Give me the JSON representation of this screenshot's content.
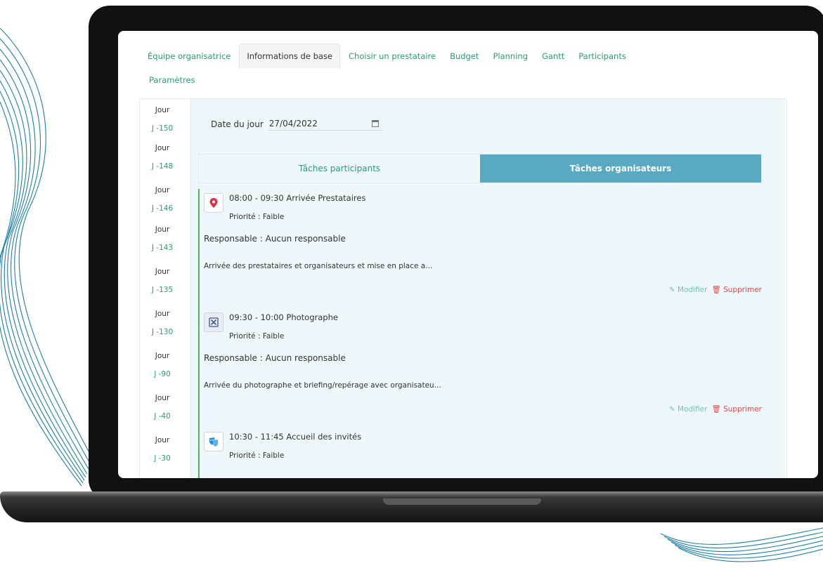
{
  "tabs": [
    {
      "label": "Équipe organisatrice",
      "active": false
    },
    {
      "label": "Informations de base",
      "active": true
    },
    {
      "label": "Choisir un prestataire",
      "active": false
    },
    {
      "label": "Budget",
      "active": false
    },
    {
      "label": "Planning",
      "active": false
    },
    {
      "label": "Gantt",
      "active": false
    },
    {
      "label": "Participants",
      "active": false
    }
  ],
  "tab_row2": {
    "label": "Paramètres"
  },
  "days": [
    {
      "label": "Jour",
      "num": "J -150"
    },
    {
      "label": "Jour",
      "num": "J -148"
    },
    {
      "label": "Jour",
      "num": "J -146"
    },
    {
      "label": "Jour",
      "num": "J -143"
    },
    {
      "label": "Jour",
      "num": "J -135"
    },
    {
      "label": "Jour",
      "num": "J -130"
    },
    {
      "label": "Jour",
      "num": "J -90"
    },
    {
      "label": "Jour",
      "num": "J -40"
    },
    {
      "label": "Jour",
      "num": "J -30"
    }
  ],
  "date": {
    "label": "Date du jour",
    "value": "27/04/2022"
  },
  "segment": {
    "participants": "Tâches participants",
    "organisateurs": "Tâches organisateurs"
  },
  "tasks": [
    {
      "icon": "map-pin-icon",
      "time_title": "08:00 - 09:30 Arrivée Prestataires",
      "priority": "Priorité : Faible",
      "responsible": "Responsable : Aucun responsable",
      "description": "Arrivée des prestataires et organisateurs et mise en place a...",
      "modify": "Modifier",
      "delete": "Supprimer"
    },
    {
      "icon": "tools-icon",
      "time_title": "09:30 - 10:00 Photographe",
      "priority": "Priorité : Faible",
      "responsible": "Responsable : Aucun responsable",
      "description": "Arrivée du photographe et briefing/repérage avec organisateu...",
      "modify": "Modifier",
      "delete": "Supprimer"
    },
    {
      "icon": "masks-icon",
      "time_title": "10:30 - 11:45 Accueil des invités",
      "priority": "Priorité : Faible"
    }
  ],
  "colors": {
    "accent": "#2a9a7e",
    "active_tab": "#5aa9c3",
    "delete": "#e14848",
    "timeline": "#5bb35e"
  }
}
